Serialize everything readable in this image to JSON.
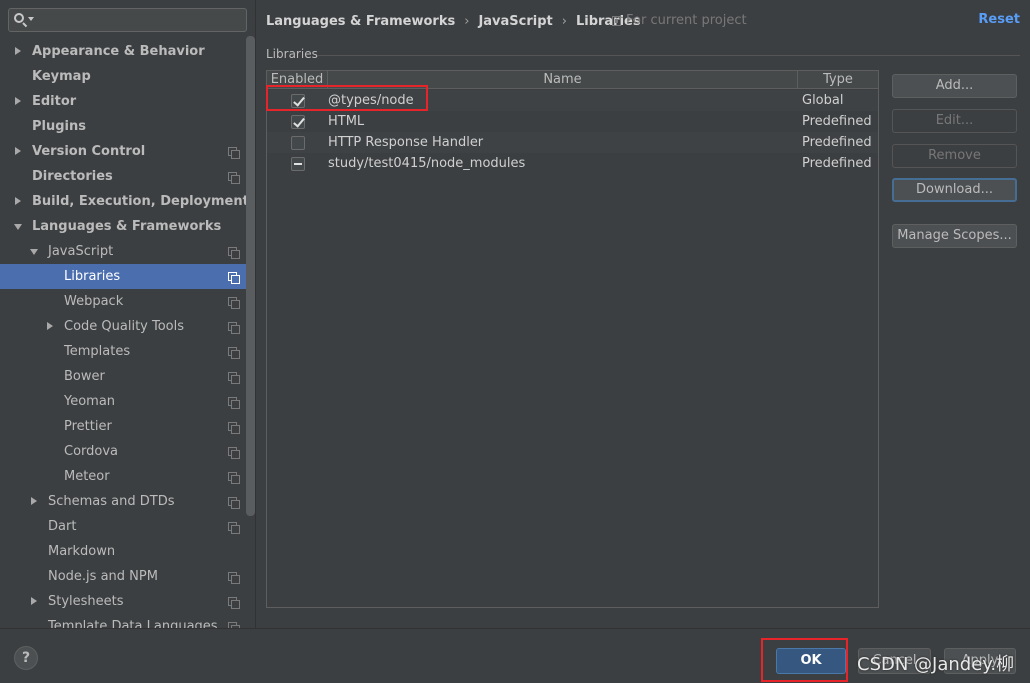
{
  "search": {
    "value": "",
    "placeholder": ""
  },
  "sidebar": {
    "items": [
      {
        "label": "Appearance & Behavior"
      },
      {
        "label": "Keymap"
      },
      {
        "label": "Editor"
      },
      {
        "label": "Plugins"
      },
      {
        "label": "Version Control"
      },
      {
        "label": "Directories"
      },
      {
        "label": "Build, Execution, Deployment"
      },
      {
        "label": "Languages & Frameworks"
      },
      {
        "label": "JavaScript"
      },
      {
        "label": "Libraries"
      },
      {
        "label": "Webpack"
      },
      {
        "label": "Code Quality Tools"
      },
      {
        "label": "Templates"
      },
      {
        "label": "Bower"
      },
      {
        "label": "Yeoman"
      },
      {
        "label": "Prettier"
      },
      {
        "label": "Cordova"
      },
      {
        "label": "Meteor"
      },
      {
        "label": "Schemas and DTDs"
      },
      {
        "label": "Dart"
      },
      {
        "label": "Markdown"
      },
      {
        "label": "Node.js and NPM"
      },
      {
        "label": "Stylesheets"
      },
      {
        "label": "Template Data Languages"
      }
    ]
  },
  "breadcrumb": {
    "items": [
      "Languages & Frameworks",
      "JavaScript",
      "Libraries"
    ],
    "separator": "›"
  },
  "scope": {
    "label": "For current project"
  },
  "reset": {
    "label": "Reset"
  },
  "section": {
    "title": "Libraries"
  },
  "table": {
    "headers": [
      "Enabled",
      "Name",
      "Type"
    ],
    "rows": [
      {
        "enabled": "checked",
        "name": "@types/node",
        "type": "Global"
      },
      {
        "enabled": "checked",
        "name": "HTML",
        "type": "Predefined"
      },
      {
        "enabled": "unchecked",
        "name": "HTTP Response Handler",
        "type": "Predefined"
      },
      {
        "enabled": "partial",
        "name": "study/test0415/node_modules",
        "type": "Predefined"
      }
    ]
  },
  "buttons": {
    "add": "Add...",
    "edit": "Edit...",
    "remove": "Remove",
    "download": "Download...",
    "manage_scopes": "Manage Scopes..."
  },
  "footer": {
    "help": "?",
    "ok": "OK",
    "cancel": "Cancel",
    "apply": "Apply"
  },
  "watermark": {
    "text": "CSDN @Jandey.柳"
  },
  "colors": {
    "background": "#3c3f41",
    "selection": "#4b6eaf",
    "link": "#589df6",
    "default_button": "#365880",
    "annotation_red": "#e8242b"
  }
}
